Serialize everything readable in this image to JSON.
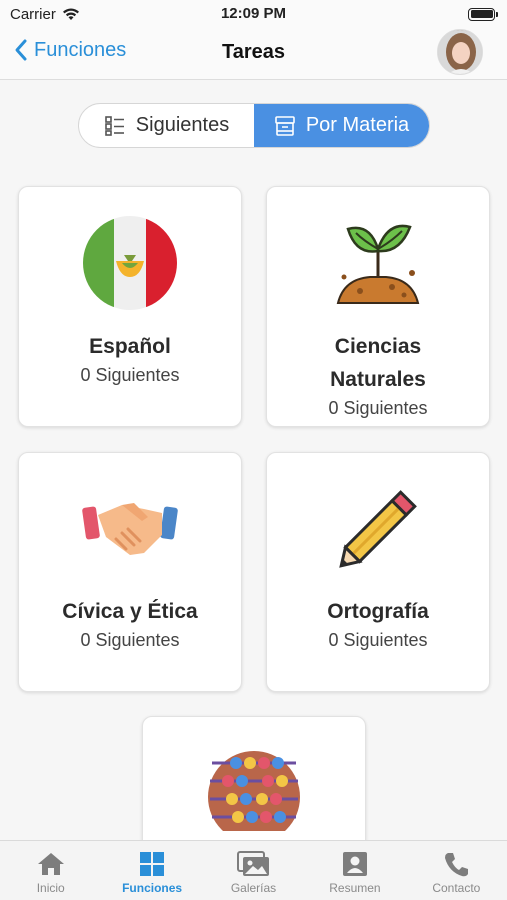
{
  "status_bar": {
    "carrier": "Carrier",
    "time": "12:09 PM"
  },
  "nav": {
    "back_label": "Funciones",
    "title": "Tareas"
  },
  "segmented": {
    "options": [
      {
        "label": "Siguientes",
        "selected": false
      },
      {
        "label": "Por Materia",
        "selected": true
      }
    ]
  },
  "subjects": [
    {
      "name": "Español",
      "count": "0 Siguientes",
      "icon": "mexico-flag-icon"
    },
    {
      "name_line1": "Ciencias",
      "name_line2": "Naturales",
      "count": "0 Siguientes",
      "icon": "plant-sprout-icon"
    },
    {
      "name": "Cívica y Ética",
      "count": "0 Siguientes",
      "icon": "handshake-icon"
    },
    {
      "name": "Ortografía",
      "count": "0 Siguientes",
      "icon": "pencil-icon"
    },
    {
      "icon": "abacus-icon"
    }
  ],
  "tab_bar": {
    "items": [
      {
        "label": "Inicio",
        "icon": "home-icon",
        "active": false
      },
      {
        "label": "Funciones",
        "icon": "grid-icon",
        "active": true
      },
      {
        "label": "Galerías",
        "icon": "gallery-icon",
        "active": false
      },
      {
        "label": "Resumen",
        "icon": "profile-card-icon",
        "active": false
      },
      {
        "label": "Contacto",
        "icon": "phone-icon",
        "active": false
      }
    ]
  },
  "colors": {
    "accent": "#2a8fd8",
    "segment_active": "#4a90e2"
  }
}
